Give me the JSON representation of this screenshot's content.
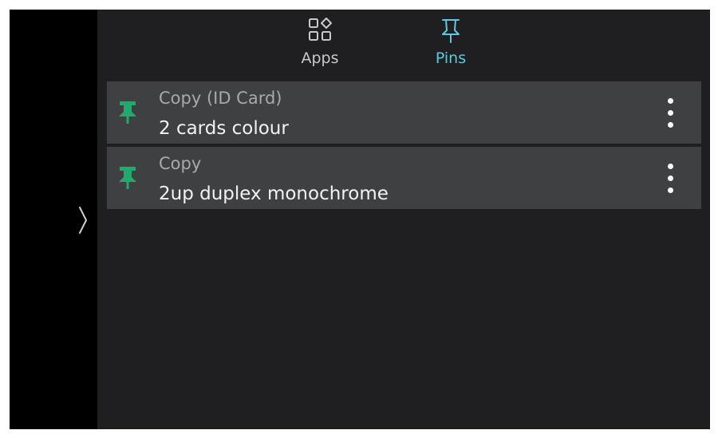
{
  "colors": {
    "frame_background": "#000000",
    "panel_background": "#1f1f21",
    "row_background": "#3f4042",
    "tab_text": "#c9c9c9",
    "tab_active_text": "#5cc9dc",
    "pin_green": "#23a86e",
    "row_title": "#a9a9a9",
    "row_subtitle": "#f2f2f2",
    "menu_dots": "#ffffff",
    "chevron": "#d0d0d0"
  },
  "nav": {
    "expand_icon": "chevron-right-icon"
  },
  "tabs": [
    {
      "label": "Apps",
      "icon": "apps-grid-icon",
      "active": false
    },
    {
      "label": "Pins",
      "icon": "pin-icon",
      "active": true
    }
  ],
  "pins": [
    {
      "title": "Copy (ID Card)",
      "subtitle": "2 cards colour",
      "icon": "pin-icon",
      "menu_icon": "more-vertical-icon"
    },
    {
      "title": "Copy",
      "subtitle": "2up duplex monochrome",
      "icon": "pin-icon",
      "menu_icon": "more-vertical-icon"
    }
  ]
}
